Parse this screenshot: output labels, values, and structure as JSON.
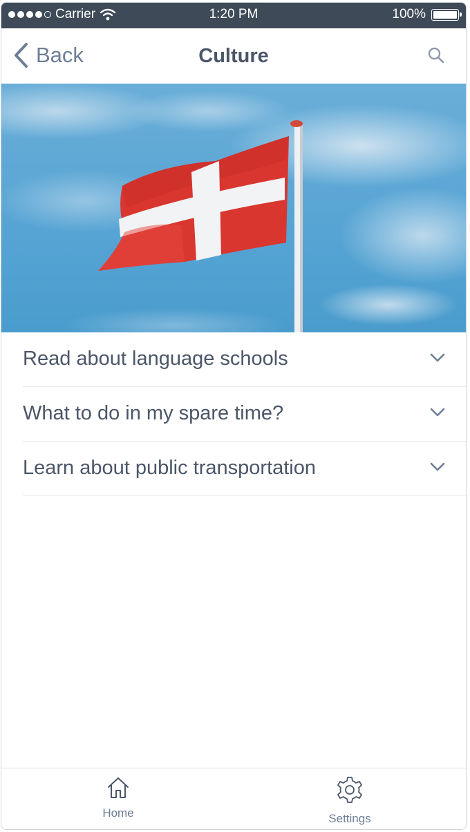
{
  "status_bar": {
    "carrier": "Carrier",
    "time": "1:20 PM",
    "battery": "100%",
    "battery_level": 1.0
  },
  "nav": {
    "back_label": "Back",
    "title": "Culture",
    "search_icon": "search-icon",
    "back_icon": "chevron-left-icon"
  },
  "hero": {
    "image": "danish-flag-on-pole-against-sky"
  },
  "accordion": {
    "items": [
      {
        "label": "Read about language schools",
        "icon": "chevron-down-icon"
      },
      {
        "label": "What to do in my spare time?",
        "icon": "chevron-down-icon"
      },
      {
        "label": "Learn about public transportation",
        "icon": "chevron-down-icon"
      }
    ]
  },
  "tab_bar": {
    "tabs": [
      {
        "label": "Home",
        "icon": "home-icon"
      },
      {
        "label": "Settings",
        "icon": "gear-icon"
      }
    ]
  },
  "colors": {
    "status_bar": "#3e4a58",
    "text": "#4b5668",
    "accent": "#6e7e96",
    "flag_red": "#d9362f"
  }
}
